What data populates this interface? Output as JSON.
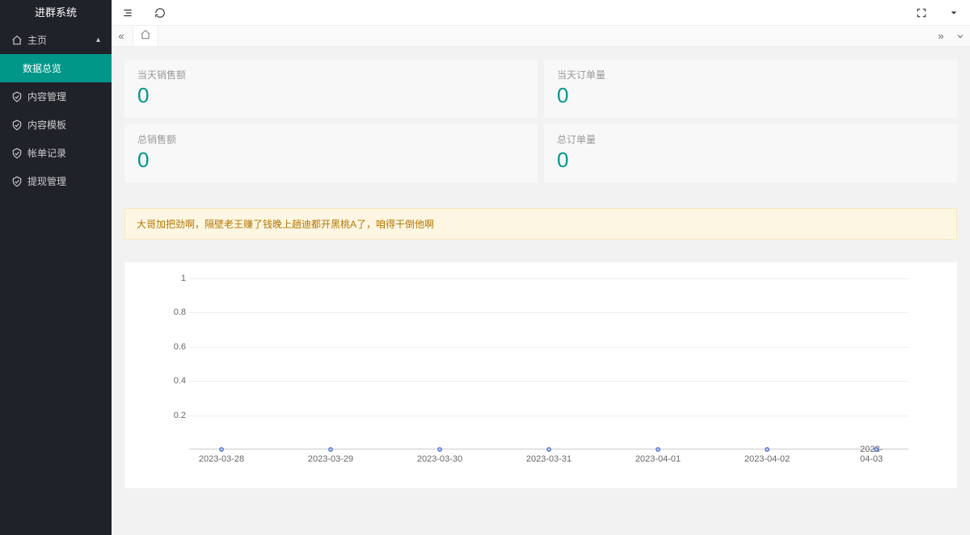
{
  "app": {
    "title": "进群系统"
  },
  "sidebar": {
    "parent": {
      "label": "主页"
    },
    "items": [
      {
        "label": "数据总览"
      },
      {
        "label": "内容管理"
      },
      {
        "label": "内容模板"
      },
      {
        "label": "帐单记录"
      },
      {
        "label": "提现管理"
      }
    ]
  },
  "stats": {
    "today_sales": {
      "label": "当天销售额",
      "value": "0"
    },
    "today_orders": {
      "label": "当天订单量",
      "value": "0"
    },
    "total_sales": {
      "label": "总销售额",
      "value": "0"
    },
    "total_orders": {
      "label": "总订单量",
      "value": "0"
    }
  },
  "notice": "大哥加把劲啊，隔壁老王赚了钱晚上趟迪都开黑桃A了，咱得干倒他啊",
  "chart_data": {
    "type": "line",
    "title": "",
    "xlabel": "",
    "ylabel": "",
    "ylim": [
      0,
      1
    ],
    "yticks": [
      0.2,
      0.4,
      0.6,
      0.8,
      1
    ],
    "categories": [
      "2023-03-28",
      "2023-03-29",
      "2023-03-30",
      "2023-03-31",
      "2023-04-01",
      "2023-04-02",
      "2023-04-03"
    ],
    "values": [
      0,
      0,
      0,
      0,
      0,
      0,
      0
    ]
  }
}
